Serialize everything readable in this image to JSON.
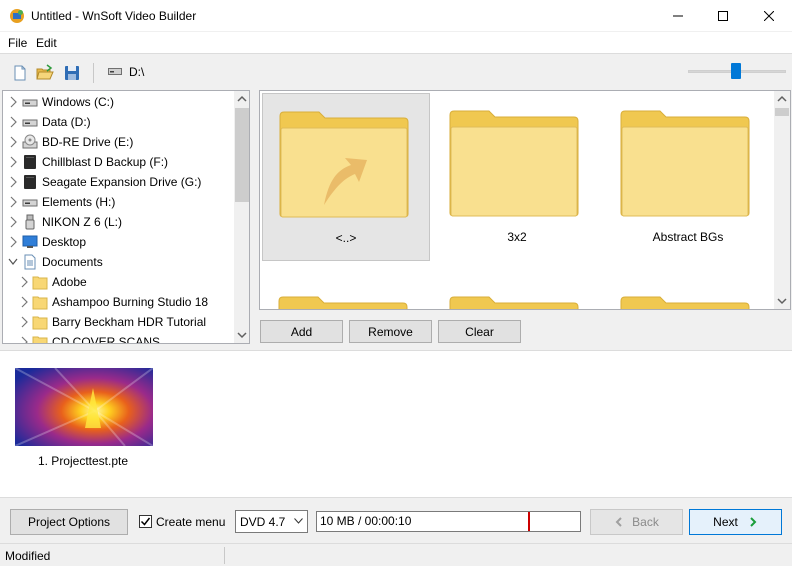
{
  "window": {
    "title": "Untitled - WnSoft Video Builder"
  },
  "menu": {
    "items": [
      "File",
      "Edit"
    ]
  },
  "toolbar": {
    "new_icon": "new-document-icon",
    "open_icon": "open-folder-icon",
    "save_icon": "save-icon",
    "drive_path": "D:\\",
    "zoom_level": 0.5
  },
  "tree": {
    "items": [
      {
        "label": "Windows (C:)",
        "icon": "drive-icon",
        "expanded": false
      },
      {
        "label": "Data (D:)",
        "icon": "drive-icon",
        "expanded": false
      },
      {
        "label": "BD-RE Drive (E:)",
        "icon": "optical-drive-icon",
        "expanded": false
      },
      {
        "label": "Chillblast D Backup (F:)",
        "icon": "external-drive-icon",
        "expanded": false
      },
      {
        "label": "Seagate Expansion Drive (G:)",
        "icon": "external-drive-icon",
        "expanded": false
      },
      {
        "label": "Elements (H:)",
        "icon": "drive-icon",
        "expanded": false
      },
      {
        "label": "NIKON Z 6   (L:)",
        "icon": "usb-drive-icon",
        "expanded": false
      },
      {
        "label": "Desktop",
        "icon": "desktop-icon",
        "expanded": false
      },
      {
        "label": "Documents",
        "icon": "documents-icon",
        "expanded": true
      },
      {
        "label": "Adobe",
        "icon": "folder-icon",
        "expanded": false
      },
      {
        "label": "Ashampoo Burning Studio 18",
        "icon": "folder-icon",
        "expanded": false
      },
      {
        "label": "Barry Beckham HDR Tutorial",
        "icon": "folder-icon",
        "expanded": false
      },
      {
        "label": "CD COVER SCANS",
        "icon": "folder-icon",
        "expanded": false
      }
    ]
  },
  "grid": {
    "folders": [
      {
        "label": "<..>",
        "icon": "parent-folder-icon",
        "selected": true
      },
      {
        "label": "3x2",
        "icon": "folder-icon",
        "selected": false
      },
      {
        "label": "Abstract BGs",
        "icon": "folder-icon",
        "selected": false
      },
      {
        "label": "",
        "icon": "folder-icon",
        "selected": false
      },
      {
        "label": "",
        "icon": "folder-icon",
        "selected": false
      },
      {
        "label": "",
        "icon": "folder-icon",
        "selected": false
      }
    ]
  },
  "actions": {
    "add": "Add",
    "remove": "Remove",
    "clear": "Clear"
  },
  "project": {
    "items": [
      {
        "label": "1. Projecttest.pte"
      }
    ]
  },
  "bottom": {
    "project_options": "Project Options",
    "create_menu_label": "Create menu",
    "create_menu_checked": true,
    "disc_type": "DVD 4.7",
    "usage_text": "10 MB / 00:00:10",
    "back": "Back",
    "next": "Next"
  },
  "status": {
    "text": "Modified"
  },
  "colors": {
    "accent": "#0078d7",
    "folder": "#f8e08e",
    "next_arrow": "#1a9e3a"
  }
}
